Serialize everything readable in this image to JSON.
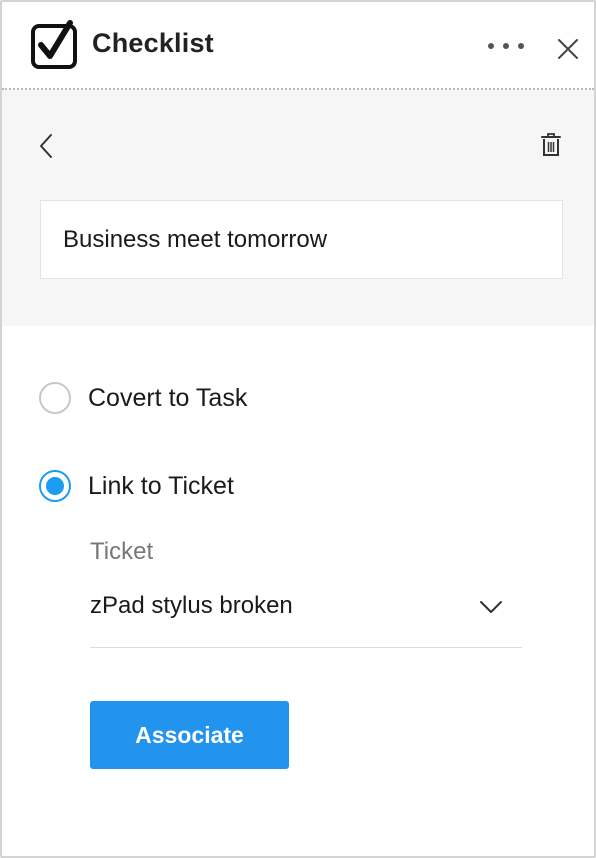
{
  "header": {
    "title": "Checklist",
    "icon": "checkbox-check-icon",
    "more_icon": "more-horizontal-icon",
    "close_icon": "close-icon"
  },
  "item": {
    "back_icon": "chevron-left-icon",
    "delete_icon": "trash-icon",
    "text": "Business meet tomorrow"
  },
  "options": [
    {
      "label": "Covert to Task",
      "selected": false
    },
    {
      "label": "Link to Ticket",
      "selected": true
    }
  ],
  "ticket": {
    "label": "Ticket",
    "selected_value": "zPad stylus broken",
    "dropdown_icon": "chevron-down-icon"
  },
  "actions": {
    "associate_label": "Associate"
  },
  "colors": {
    "accent": "#2294ee",
    "radio_selected": "#1b9df0",
    "grey_background": "#f6f6f6"
  }
}
